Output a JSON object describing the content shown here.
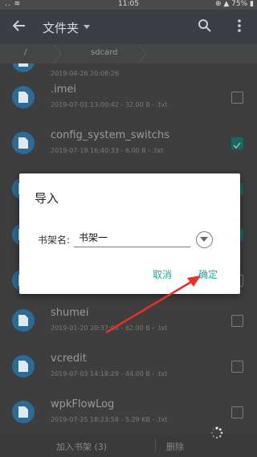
{
  "status_bar": {
    "left": "..  ≋",
    "time": "11:05",
    "right": "⊕ ▲ 75% ▮"
  },
  "app_bar": {
    "title": "文件夹",
    "back_icon": "back-arrow-icon",
    "search_icon": "search-icon",
    "more_icon": "more-vert-icon"
  },
  "path": {
    "segments": [
      "/",
      "sdcard"
    ]
  },
  "files": [
    {
      "name": "",
      "meta": "2019-04-26 20:08:26",
      "checked": false
    },
    {
      "name": ".imei",
      "meta": "2019-07-01 13:00:42 - 32.00 B - .txt",
      "checked": false
    },
    {
      "name": "config_system_switchs",
      "meta": "2019-07-19 16:40:33 - 6.00 B - .txt",
      "checked": true
    },
    {
      "name": "",
      "meta": "",
      "checked": true
    },
    {
      "name": "",
      "meta": "",
      "checked": true
    },
    {
      "name": "",
      "meta": "",
      "checked": false
    },
    {
      "name": "shumei",
      "meta": "2019-01-20 20:37:06 - 62.00 B - .txt",
      "checked": false
    },
    {
      "name": "vcredit",
      "meta": "2019-07-03 14:18:29 - 44.00 B - .txt",
      "checked": false
    },
    {
      "name": "wpkFlowLog",
      "meta": "2019-07-25 18:23:58 - 5.29 KB - .txt",
      "checked": false
    }
  ],
  "bottom_bar": {
    "add_label": "加入书架 (3)",
    "delete_label": "删除"
  },
  "dialog": {
    "title": "导入",
    "field_label": "书架名:",
    "field_value": "书架一",
    "cancel_label": "取消",
    "ok_label": "确定"
  },
  "colors": {
    "accent": "#26a69a",
    "file_icon": "#2d6b96",
    "checked": "#17695f",
    "annotation_arrow": "#e8302a"
  }
}
